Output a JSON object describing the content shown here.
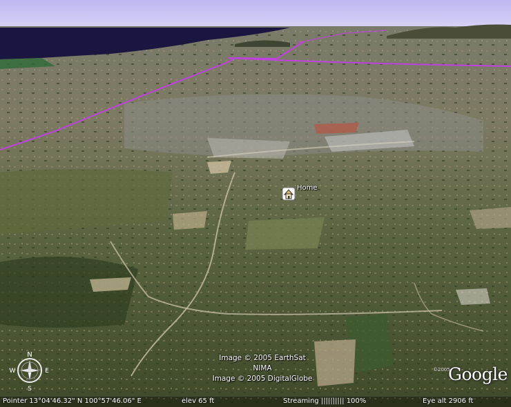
{
  "placemark": {
    "label": "Home",
    "icon": "home-placemark-icon"
  },
  "attribution": {
    "line1": "Image © 2005 EarthSat",
    "line2": "NIMA",
    "line3": "Image © 2005 DigitalGlobe"
  },
  "logo": {
    "copyright": "©2005",
    "text": "Google"
  },
  "compass": {
    "north": "N",
    "south": "S",
    "east": "E",
    "west": "W",
    "icon": "compass-icon"
  },
  "status": {
    "pointer": "Pointer  13°04'46.32\" N  100°57'46.06\" E",
    "elev": "elev    65 ft",
    "streaming": "Streaming |||||||||| 100%",
    "eye_alt": "Eye  alt    2906 ft"
  },
  "colors": {
    "border_line": "#c040e0",
    "sea": "#1a1640",
    "sky": "#ccc7f3"
  }
}
